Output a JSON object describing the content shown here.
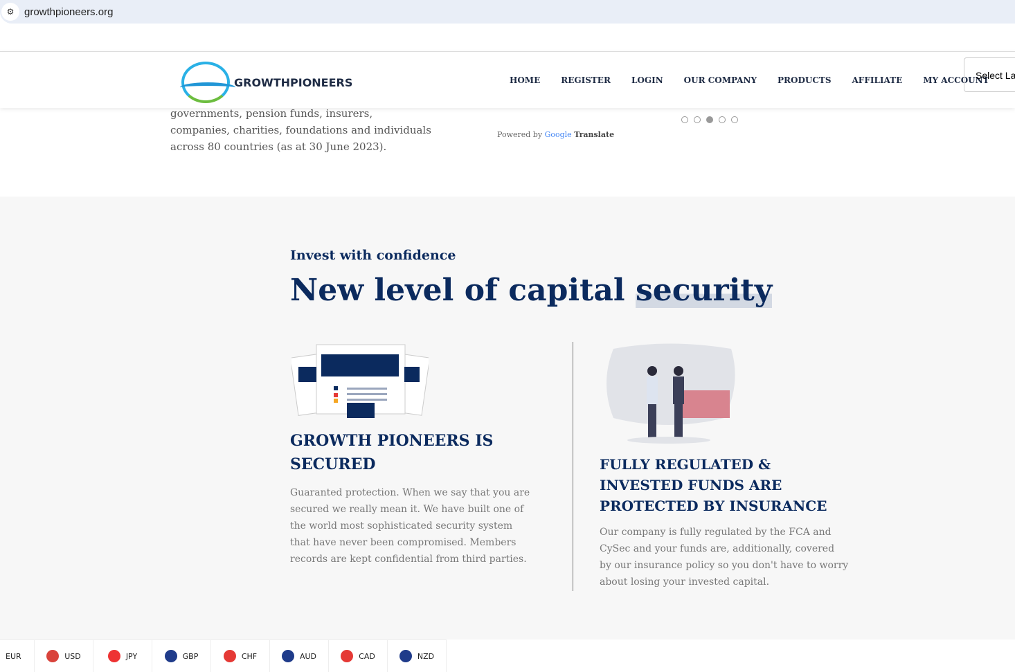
{
  "browser": {
    "url": "growthpioneers.org"
  },
  "header": {
    "brand": "GROWTHPIONEERS",
    "nav": [
      "HOME",
      "REGISTER",
      "LOGIN",
      "OUR COMPANY",
      "PRODUCTS",
      "AFFILIATE",
      "MY ACCOUNT"
    ],
    "language_select": "Select Language"
  },
  "intro": {
    "text": "governments, pension funds, insurers, companies, charities, foundations and individuals across 80 countries (as at 30 June 2023).",
    "powered_by": "Powered by",
    "google": "Google",
    "translate": "Translate"
  },
  "carousel": {
    "slides": 5,
    "active": 3
  },
  "section": {
    "kicker": "Invest with confidence",
    "title_a": "New level of capital",
    "title_b": "security",
    "features": [
      {
        "title": "GROWTH PIONEERS IS SECURED",
        "text": "Guaranted protection. When we say that you are secured we really mean it. We have built one of the world most sophisticated security system that have never been compromised. Members records are kept confidential from third parties."
      },
      {
        "title": "FULLY REGULATED & INVESTED FUNDS ARE PROTECTED BY INSURANCE",
        "text": "Our company is fully regulated by the FCA and CySec and your funds are, additionally, covered by our insurance policy so you don't have to worry about losing your invested capital."
      }
    ]
  },
  "ticker": [
    {
      "code": "EUR",
      "color": "#1f4ea8"
    },
    {
      "code": "USD",
      "color": "#d9433b"
    },
    {
      "code": "JPY",
      "color": "#e33"
    },
    {
      "code": "GBP",
      "color": "#1f3b8a"
    },
    {
      "code": "CHF",
      "color": "#e53935"
    },
    {
      "code": "AUD",
      "color": "#1f3b8a"
    },
    {
      "code": "CAD",
      "color": "#e53935"
    },
    {
      "code": "NZD",
      "color": "#1f3b8a"
    }
  ]
}
